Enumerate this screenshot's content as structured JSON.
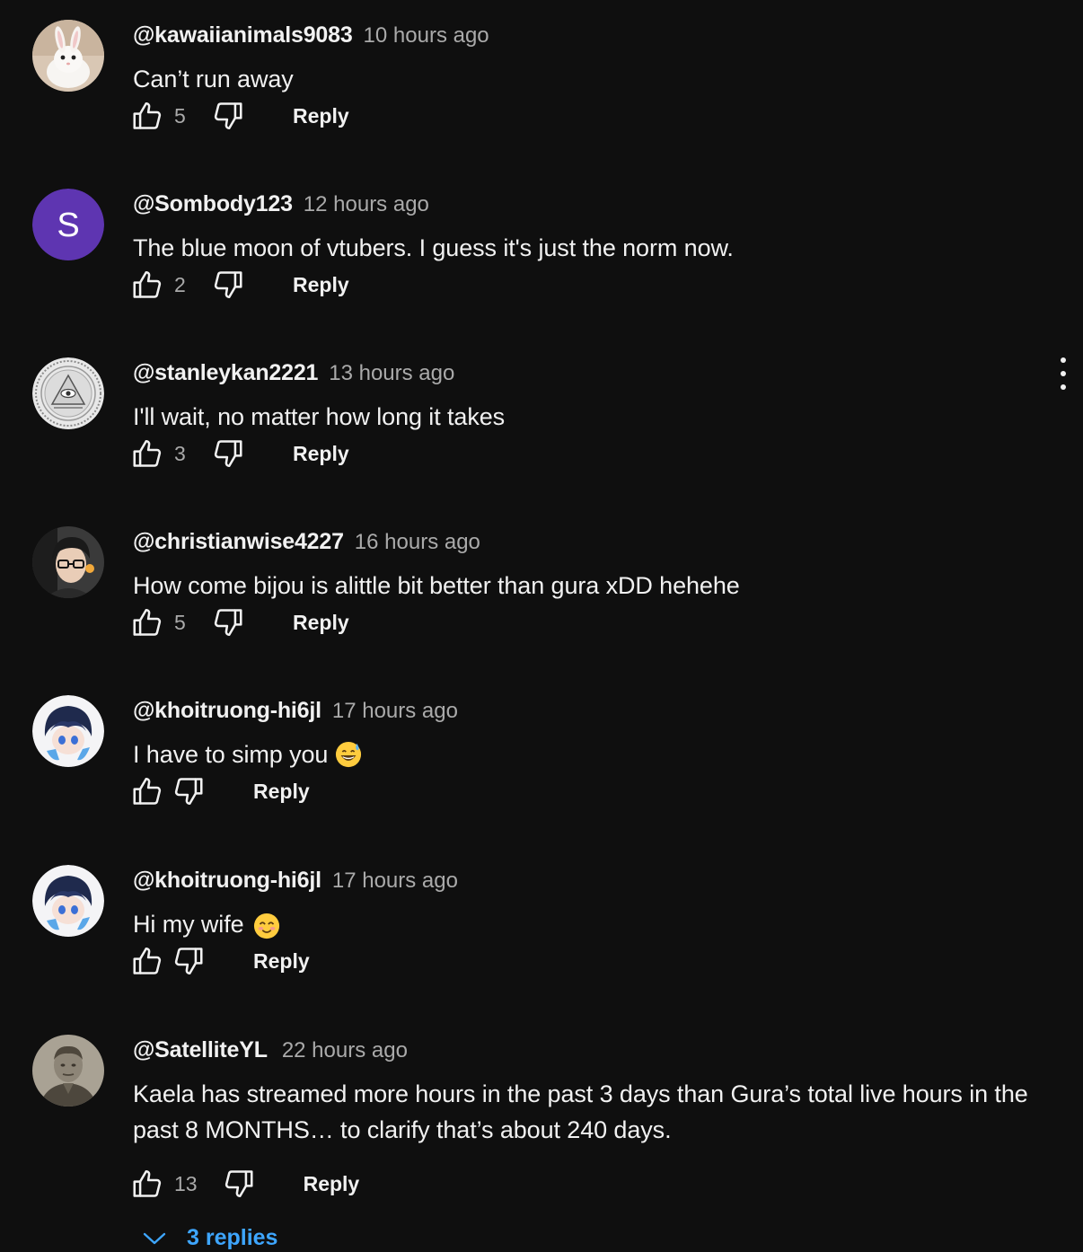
{
  "comments": [
    {
      "author": "@kawaiianimals9083",
      "time": "10 hours ago",
      "text": "Can’t run away",
      "likes": "5",
      "reply_label": "Reply",
      "avatar": "white-bunny-photo"
    },
    {
      "author": "@Sombody123",
      "time": "12 hours ago",
      "text": "The blue moon of vtubers. I guess it's just the norm now.",
      "likes": "2",
      "reply_label": "Reply",
      "avatar": "letter-avatar",
      "avatar_letter": "S",
      "avatar_color": "#5e35b1"
    },
    {
      "author": "@stanleykan2221",
      "time": "13 hours ago",
      "text": "I'll wait, no matter how long it takes",
      "likes": "3",
      "reply_label": "Reply",
      "avatar": "eye-of-providence-seal"
    },
    {
      "author": "@christianwise4227",
      "time": "16 hours ago",
      "text": "How come bijou is alittle bit better than gura xDD hehehe",
      "likes": "5",
      "reply_label": "Reply",
      "avatar": "person-with-glasses-photo"
    },
    {
      "author": "@khoitruong-hi6jl",
      "time": "17 hours ago",
      "text": "I have to simp you",
      "emoji": "grinning-face-with-sweat",
      "likes": "",
      "reply_label": "Reply",
      "avatar": "anime-character-blue-hair"
    },
    {
      "author": "@khoitruong-hi6jl",
      "time": "17 hours ago",
      "text": "Hi my wife",
      "emoji": "smiling-face-with-smiling-eyes",
      "likes": "",
      "reply_label": "Reply",
      "avatar": "anime-character-blue-hair"
    },
    {
      "author": "@SatelliteYL",
      "time": "22 hours ago",
      "text": "Kaela has streamed more hours in the past 3 days than Gura’s total live hours in the past 8 MONTHS… to clarify that’s about 240 days.",
      "likes": "13",
      "reply_label": "Reply",
      "avatar": "vintage-portrait-photo"
    }
  ],
  "replies_toggle": {
    "label": "3 replies",
    "icon": "chevron-down-icon"
  },
  "colors": {
    "background": "#0f0f0f",
    "text": "#f1f1f1",
    "secondary_text": "#aaaaaa",
    "link": "#3ea6ff"
  }
}
